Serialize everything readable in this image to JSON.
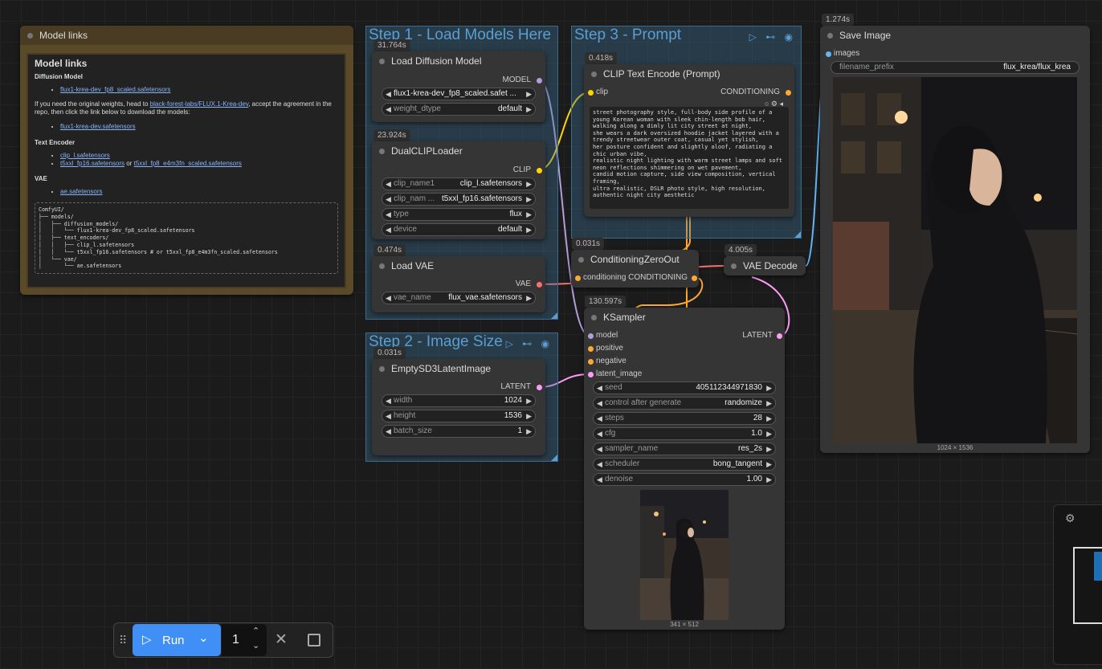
{
  "notes": {
    "model_links": {
      "node_title": "Model links",
      "heading": "Model links",
      "diffusion_heading": "Diffusion Model",
      "diffusion_link": "flux1-krea-dev_fp8_scaled.safetensors",
      "note_prefix": "If you need the original weights, head to ",
      "note_link": "black-forest-labs/FLUX.1-Krea-dev",
      "note_suffix": ", accept the agreement in the repo, then click the link below to download the models:",
      "original_link": "flux1-krea-dev.safetensors",
      "text_encoder_heading": "Text Encoder",
      "te_link1": "clip_l.safetensors",
      "te_link2": "t5xxl_fp16.safetensors",
      "te_or": " or ",
      "te_link3": "t5xxl_fp8_e4m3fn_scaled.safetensors",
      "vae_heading": "VAE",
      "vae_link": "ae.safetensors",
      "tree": "ComfyUI/\n├── models/\n│   ├── diffusion_models/\n│   │   └── flux1-krea-dev_fp8_scaled.safetensors\n│   ├── text_encoders/\n│   │   ├── clip_l.safetensors\n│   │   └── t5xxl_fp16.safetensors # or t5xxl_fp8_e4m3fn_scaled.safetensors\n│   └── vae/\n│       └── ae.safetensors"
    }
  },
  "groups": {
    "step1": "Step 1 - Load Models Here",
    "step2": "Step 2 - Image Size",
    "step3": "Step 3 - Prompt",
    "icons": "▷ ⊷ ◉"
  },
  "nodes": {
    "load_diffusion": {
      "time": "31.764s",
      "title": "Load Diffusion Model",
      "out": "MODEL",
      "w1_value": "flux1-krea-dev_fp8_scaled.safet ...",
      "w2_label": "weight_dtype",
      "w2_value": "default"
    },
    "dual_clip": {
      "time": "23.924s",
      "title": "DualCLIPLoader",
      "out": "CLIP",
      "w1_label": "clip_name1",
      "w1_value": "clip_l.safetensors",
      "w2_label": "clip_nam ...",
      "w2_value": "t5xxl_fp16.safetensors",
      "w3_label": "type",
      "w3_value": "flux",
      "w4_label": "device",
      "w4_value": "default"
    },
    "load_vae": {
      "time": "0.474s",
      "title": "Load VAE",
      "out": "VAE",
      "w1_label": "vae_name",
      "w1_value": "flux_vae.safetensors"
    },
    "empty_latent": {
      "time": "0.031s",
      "title": "EmptySD3LatentImage",
      "out": "LATENT",
      "w1_label": "width",
      "w1_value": "1024",
      "w2_label": "height",
      "w2_value": "1536",
      "w3_label": "batch_size",
      "w3_value": "1"
    },
    "clip_text": {
      "time": "0.418s",
      "title": "CLIP Text Encode (Prompt)",
      "in": "clip",
      "out": "CONDITIONING",
      "text": "street photography style, full-body side profile of a young Korean woman with sleek chin-length bob hair,\nwalking along a dimly lit city street at night,\nshe wears a dark oversized hoodie jacket layered with a trendy streetwear outer coat, casual yet stylish,\nher posture confident and slightly aloof, radiating a chic urban vibe,\nrealistic night lighting with warm street lamps and soft neon reflections shimmering on wet pavement,\ncandid motion capture, side view composition, vertical framing,\nultra realistic, DSLR photo style, high resolution, authentic night city aesthetic"
    },
    "cond_zero": {
      "time": "0.031s",
      "title": "ConditioningZeroOut",
      "in": "conditioning",
      "out": "CONDITIONING"
    },
    "vae_decode": {
      "time": "4.005s",
      "title": "VAE Decode"
    },
    "ksampler": {
      "time": "130.597s",
      "title": "KSampler",
      "out": "LATENT",
      "in1": "model",
      "in2": "positive",
      "in3": "negative",
      "in4": "latent_image",
      "w1_label": "seed",
      "w1_value": "405112344971830",
      "w2_label": "control after generate",
      "w2_value": "randomize",
      "w3_label": "steps",
      "w3_value": "28",
      "w4_label": "cfg",
      "w4_value": "1.0",
      "w5_label": "sampler_name",
      "w5_value": "res_2s",
      "w6_label": "scheduler",
      "w6_value": "bong_tangent",
      "w7_label": "denoise",
      "w7_value": "1.00",
      "preview_dims": "341 × 512"
    },
    "save_image": {
      "time": "1.274s",
      "title": "Save Image",
      "in": "images",
      "w1_label": "filename_prefix",
      "w1_value": "flux_krea/flux_krea",
      "preview_dims": "1024 × 1536"
    }
  },
  "runbar": {
    "run_label": "Run",
    "batch_count": "1"
  },
  "colors": {
    "model": "#b39ddb",
    "clip": "#ffd500",
    "vae": "#ff6e6e",
    "latent": "#ff9cf9",
    "conditioning": "#ffa931",
    "image": "#64b5f6"
  }
}
